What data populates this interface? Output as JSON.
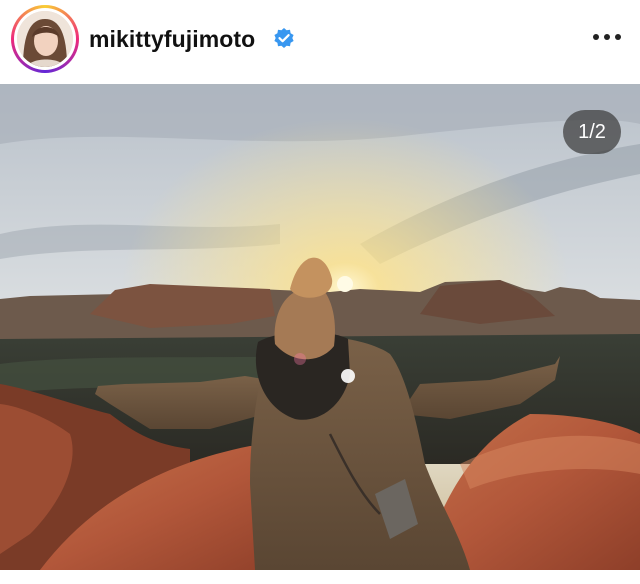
{
  "post": {
    "username": "mikittyfujimoto",
    "verified": true,
    "avatar_icon": "profile-photo",
    "verified_icon": "verified-badge-icon",
    "more_icon": "more-options-icon",
    "image_counter": "1/2",
    "image_icon": "landscape-photo"
  },
  "colors": {
    "verified_blue": "#3897f0",
    "text": "#111111",
    "counter_bg": "#3c3c3c"
  }
}
